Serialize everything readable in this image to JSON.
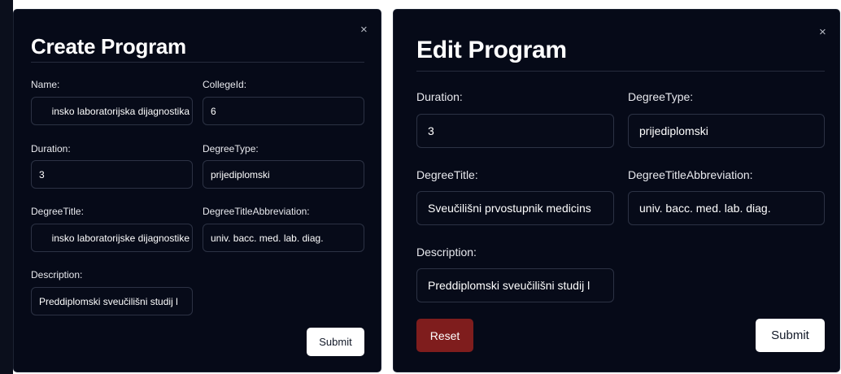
{
  "create_program": {
    "title": "Create Program",
    "close_glyph": "×",
    "fields": {
      "name": {
        "label": "Name:",
        "value": "insko laboratorijska dijagnostika"
      },
      "college_id": {
        "label": "CollegeId:",
        "value": "6"
      },
      "duration": {
        "label": "Duration:",
        "value": "3"
      },
      "degree_type": {
        "label": "DegreeType:",
        "value": "prijediplomski"
      },
      "degree_title": {
        "label": "DegreeTitle:",
        "value": "insko laboratorijske dijagnostike"
      },
      "degree_title_abbreviation": {
        "label": "DegreeTitleAbbreviation:",
        "value": "univ. bacc. med. lab. diag."
      },
      "description": {
        "label": "Description:",
        "value": "Preddiplomski sveučilišni studij l"
      }
    },
    "submit_label": "Submit"
  },
  "edit_program": {
    "title": "Edit Program",
    "close_glyph": "×",
    "fields": {
      "duration": {
        "label": "Duration:",
        "value": "3"
      },
      "degree_type": {
        "label": "DegreeType:",
        "value": "prijediplomski"
      },
      "degree_title": {
        "label": "DegreeTitle:",
        "value": "Sveučilišni prvostupnik medicins"
      },
      "degree_title_abbreviation": {
        "label": "DegreeTitleAbbreviation:",
        "value": "univ. bacc. med. lab. diag."
      },
      "description": {
        "label": "Description:",
        "value": "Preddiplomski sveučilišni studij l"
      }
    },
    "reset_label": "Reset",
    "submit_label": "Submit"
  },
  "colors": {
    "modal_background": "#060a18",
    "input_border": "#2c3244",
    "submit_background": "#ffffff",
    "reset_background": "#7f1d1d"
  }
}
